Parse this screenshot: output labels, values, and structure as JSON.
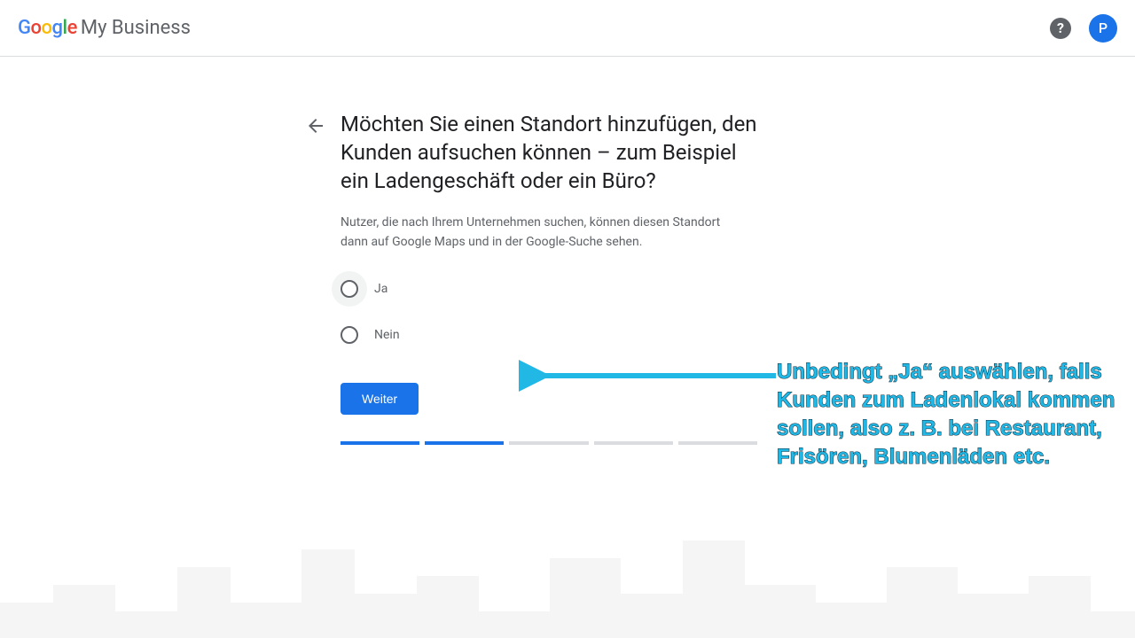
{
  "header": {
    "product_name": "My Business",
    "avatar_initial": "P"
  },
  "form": {
    "heading": "Möchten Sie einen Standort hinzufügen, den Kunden aufsuchen können – zum Beispiel ein Ladengeschäft oder ein Büro?",
    "subtext": "Nutzer, die nach Ihrem Unternehmen suchen, können diesen Standort dann auf Google Maps und in der Google-Suche sehen.",
    "options": [
      {
        "label": "Ja",
        "selected": false,
        "focused": true
      },
      {
        "label": "Nein",
        "selected": false,
        "focused": false
      }
    ],
    "button_label": "Weiter",
    "progress_total": 5,
    "progress_active": 2
  },
  "annotation": {
    "text": "Unbedingt „Ja“ auswählen, falls Kunden zum Ladenlokal kommen sollen, also z. B. bei Restaurant, Frisören, Blumenläden etc.",
    "arrow_color": "#22b8e6"
  }
}
